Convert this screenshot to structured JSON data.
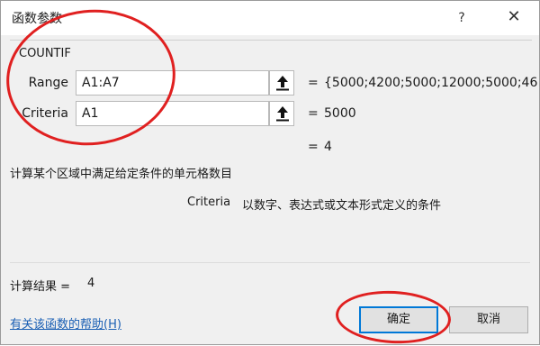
{
  "window": {
    "title": "函数参数",
    "help_glyph": "?",
    "close_glyph": "✕"
  },
  "function": {
    "name": "COUNTIF"
  },
  "arguments": [
    {
      "label": "Range",
      "input": "A1:A7",
      "equals": "=",
      "value": "{5000;4200;5000;12000;5000;46"
    },
    {
      "label": "Criteria",
      "input": "A1",
      "equals": "=",
      "value": "5000"
    }
  ],
  "formula_result": {
    "equals": "=",
    "value": "4"
  },
  "description": {
    "function": "计算某个区域中满足给定条件的单元格数目",
    "arg_name": "Criteria",
    "arg_text": "以数字、表达式或文本形式定义的条件"
  },
  "result": {
    "label": "计算结果 =",
    "value": "4"
  },
  "help_link": "有关该函数的帮助(H)",
  "buttons": {
    "ok": "确定",
    "cancel": "取消"
  },
  "colors": {
    "annotation": "#e02020",
    "link": "#1a5fb4",
    "default_button_border": "#0078d7"
  }
}
